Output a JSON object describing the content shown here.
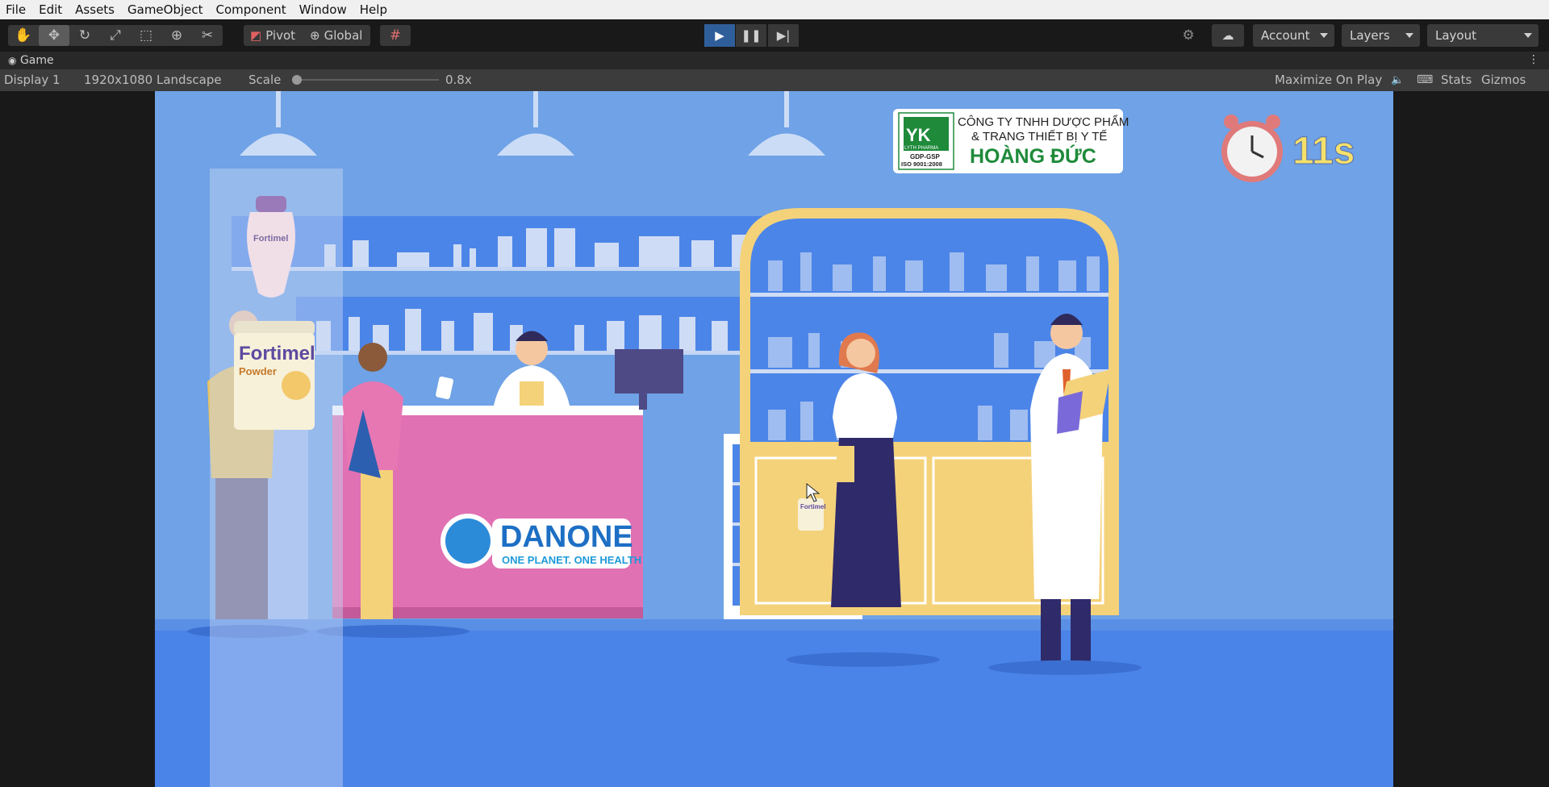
{
  "menu": [
    "File",
    "Edit",
    "Assets",
    "GameObject",
    "Component",
    "Window",
    "Help"
  ],
  "toolbar": {
    "tools": [
      "hand-tool",
      "move-tool",
      "rotate-tool",
      "scale-tool",
      "rect-tool",
      "transform-tool",
      "custom-tool"
    ],
    "pivot_label": "Pivot",
    "global_label": "Global",
    "account_label": "Account",
    "layers_label": "Layers",
    "layout_label": "Layout"
  },
  "game": {
    "tab_label": "Game",
    "display_label": "Display 1",
    "resolution_label": "1920x1080 Landscape",
    "scale_label": "Scale",
    "scale_value": "0.8x",
    "scale_fraction": 0.0,
    "maximize_label": "Maximize On Play",
    "stats_label": "Stats",
    "gizmos_label": "Gizmos"
  },
  "scene": {
    "company_line1": "CÔNG TY TNHH DƯỢC PHẨM",
    "company_line2": "& TRANG THIẾT BỊ Y TẾ",
    "company_name": "HOÀNG ĐỨC",
    "logo_small": "LYTH PHARMA",
    "logo_cert1": "GDP-GSP",
    "logo_cert2": "ISO 9001:2008",
    "timer": "11s",
    "danone_name": "DANONE",
    "danone_tagline": "ONE PLANET. ONE HEALTH",
    "product_name": "Fortimel",
    "product_sub": "Powder",
    "bottle_label": "Fortimel",
    "shelf_can_label": "Fortimel"
  },
  "colors": {
    "sky": "#6fa2e6",
    "floor": "#4a84e8",
    "counter_pink": "#e071b3",
    "accent_blue": "#2f5f9a",
    "cabinet_yellow": "#f4d27a"
  }
}
